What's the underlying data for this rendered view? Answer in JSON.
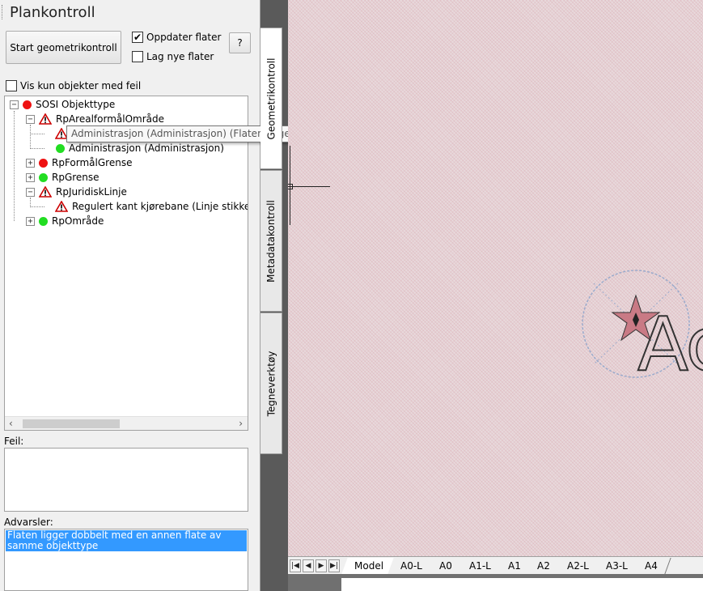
{
  "panel": {
    "title": "Plankontroll",
    "start_button": "Start geometrikontroll",
    "oppdater_label": "Oppdater flater",
    "oppdater_checked": true,
    "lag_nye_label": "Lag nye flater",
    "lag_nye_checked": false,
    "help_button": "?",
    "vis_kun_label": "Vis kun objekter med feil",
    "vis_kun_checked": false
  },
  "tree": {
    "root": "SOSI Objekttype",
    "items": [
      {
        "label": "RpArealformålOmråde",
        "status": "warning"
      },
      {
        "label": "Administrasjon (Administrasjon)",
        "status": "ok"
      },
      {
        "label": "RpFormålGrense",
        "status": "error"
      },
      {
        "label": "RpGrense",
        "status": "ok"
      },
      {
        "label": "RpJuridiskLinje",
        "status": "warning"
      },
      {
        "label": "Regulert kant kjørebane (Linje stikker",
        "status": "warning"
      },
      {
        "label": "RpOmråde",
        "status": "ok"
      }
    ],
    "tooltip": "Administrasjon (Administrasjon) (Flaten ligger dobbelt med en annen flate av samme objekttype)"
  },
  "feil": {
    "label": "Feil:"
  },
  "advarsler": {
    "label": "Advarsler:",
    "selected": "Flaten ligger dobbelt med en annen flate av samme objekttype"
  },
  "side_tabs": [
    "Geometrikontroll",
    "Metadatakontroll",
    "Tegneverktøy"
  ],
  "layout_tabs": [
    "Model",
    "A0-L",
    "A0",
    "A1-L",
    "A1",
    "A2",
    "A2-L",
    "A3-L",
    "A4"
  ],
  "canvas": {
    "visible_text": "Ac"
  },
  "colors": {
    "error": "#ee1111",
    "ok": "#22dd22",
    "warning": "#cc0000",
    "selection": "#3399ff"
  }
}
